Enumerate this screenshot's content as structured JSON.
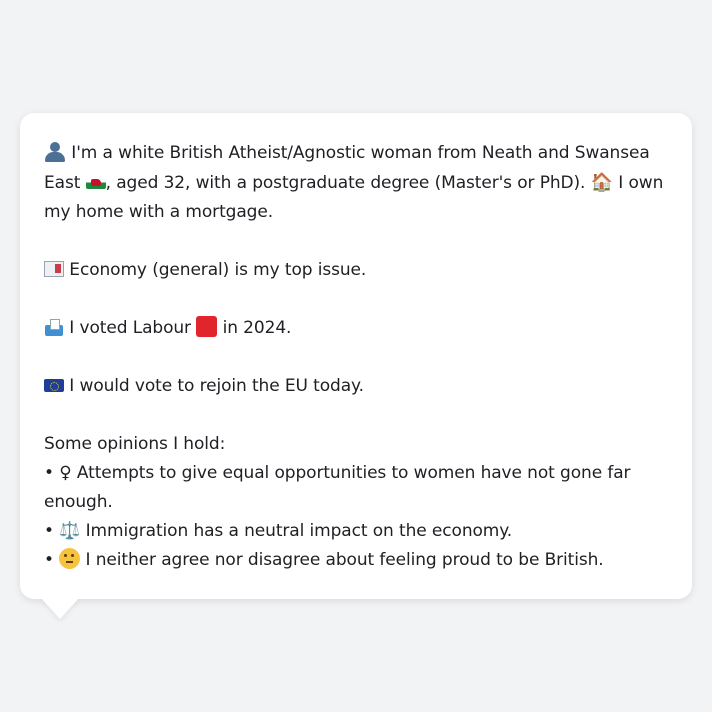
{
  "message": {
    "intro": {
      "part1": " I'm a white British Atheist/Agnostic woman from Neath and Swansea East",
      "part2": ", aged 32, with a postgraduate degree (Master's or PhD). ",
      "part3": " I own my home with a mortgage."
    },
    "top_issue": " Economy (general) is my top issue.",
    "vote": {
      "before": " I voted Labour ",
      "after": " in 2024."
    },
    "eu": " I would vote to rejoin the EU today.",
    "opinions_heading": "Some opinions I hold:",
    "opinions": [
      {
        "bullet": "• ",
        "icon": "♀",
        "text": "  Attempts to give equal opportunities to women have not gone far enough."
      },
      {
        "bullet": "• ",
        "icon": "⚖️",
        "text": " Immigration has a neutral impact on the economy."
      },
      {
        "bullet": "• ",
        "icon": "🤔",
        "text": " I neither agree nor disagree about feeling proud to be British."
      }
    ],
    "icons": {
      "person": "person-silhouette-icon",
      "wales": "wales-flag-icon",
      "house": "🏠",
      "newspaper": "newspaper-icon",
      "ballot": "ballot-box-icon",
      "labour_color": "#e0262c",
      "eu": "eu-flag-icon"
    }
  }
}
